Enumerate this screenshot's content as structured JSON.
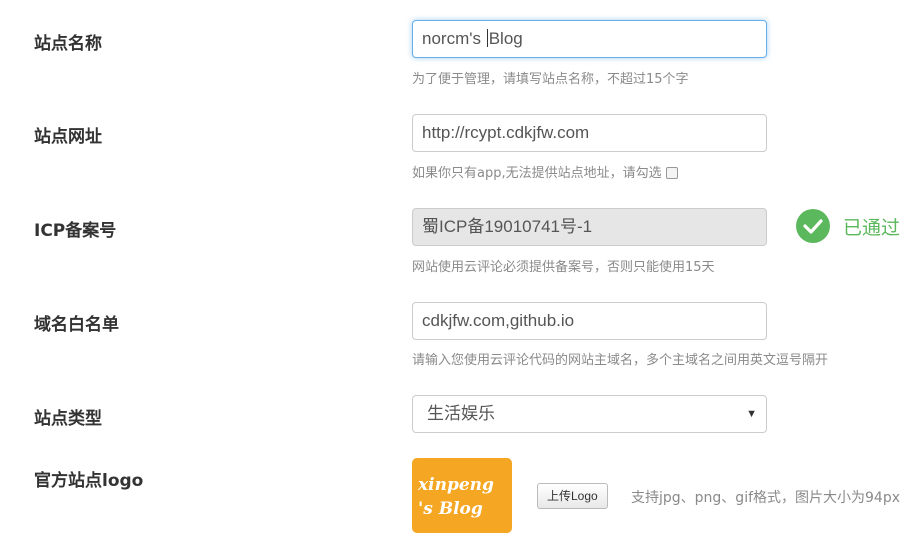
{
  "site_name": {
    "label": "站点名称",
    "value_before_caret": "norcm's ",
    "value_after_caret": "Blog",
    "help": "为了便于管理，请填写站点名称，不超过15个字"
  },
  "site_url": {
    "label": "站点网址",
    "value": "http://rcypt.cdkjfw.com",
    "help": "如果你只有app,无法提供站点地址，请勾选"
  },
  "icp": {
    "label": "ICP备案号",
    "value": "蜀ICP备19010741号-1",
    "status": "已通过",
    "status_color": "#5cb85c",
    "help": "网站使用云评论必须提供备案号，否则只能使用15天"
  },
  "whitelist": {
    "label": "域名白名单",
    "value": "cdkjfw.com,github.io",
    "help": "请输入您使用云评论代码的网站主域名，多个主域名之间用英文逗号隔开"
  },
  "site_type": {
    "label": "站点类型",
    "selected": "生活娱乐"
  },
  "logo": {
    "label": "官方站点logo",
    "logo_text_line1": "xinpeng",
    "logo_text_line2": "'s Blog",
    "logo_bg": "#f5a623",
    "upload_button": "上传Logo",
    "hint": "支持jpg、png、gif格式，图片大小为94px"
  }
}
